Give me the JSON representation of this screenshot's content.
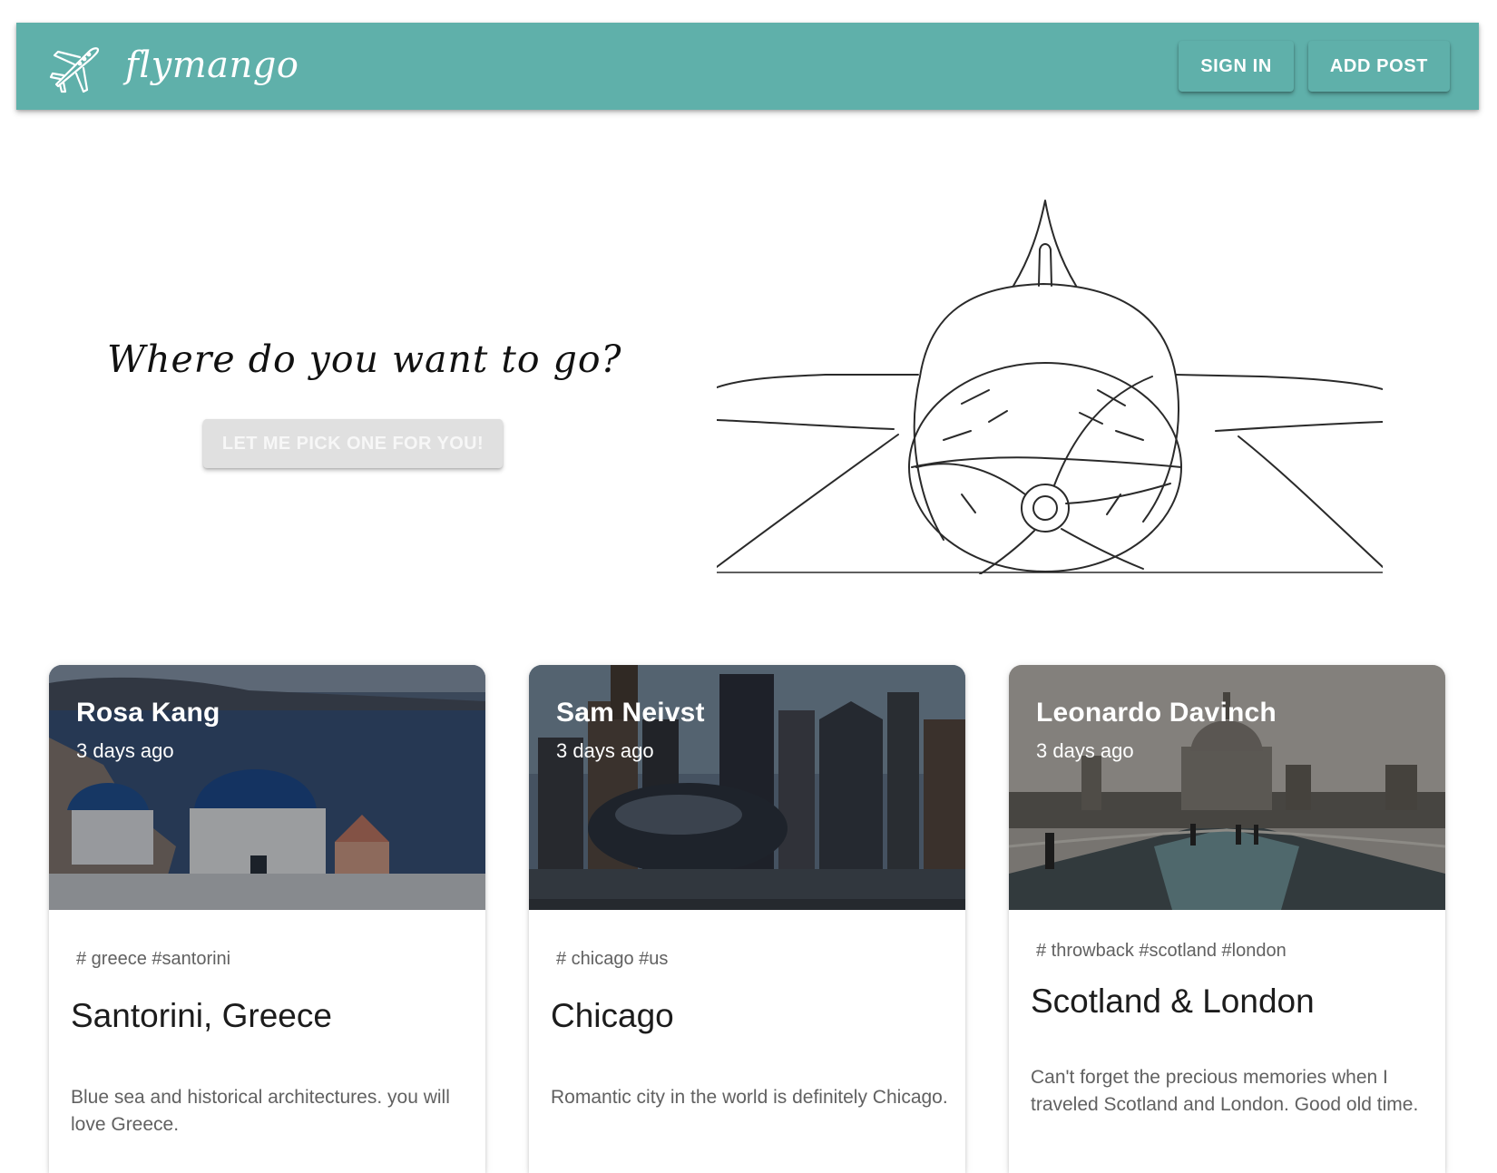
{
  "appbar": {
    "brand": "flymango",
    "logo_icon": "airplane-icon",
    "sign_in_label": "SIGN IN",
    "add_post_label": "ADD POST",
    "color": "#5fb0aa"
  },
  "hero": {
    "heading": "Where do you want to go?",
    "pick_button_label": "LET ME PICK ONE FOR YOU!",
    "illustration": "airplane-sketch"
  },
  "posts": [
    {
      "author": "Rosa Kang",
      "date": "3 days ago",
      "tags": "# greece #santorini",
      "title": "Santorini, Greece",
      "description": "Blue sea and historical architectures. you will love Greece.",
      "image": "santorini-photo"
    },
    {
      "author": "Sam Neivst",
      "date": "3 days ago",
      "tags": "# chicago #us",
      "title": "Chicago",
      "description": "Romantic city in the world is definitely Chicago.",
      "image": "chicago-photo"
    },
    {
      "author": "Leonardo Davinch",
      "date": "3 days ago",
      "tags": "# throwback #scotland #london",
      "title": "Scotland & London",
      "description": "Can't forget the precious memories when I traveled Scotland and London. Good old time.",
      "image": "london-photo"
    }
  ]
}
